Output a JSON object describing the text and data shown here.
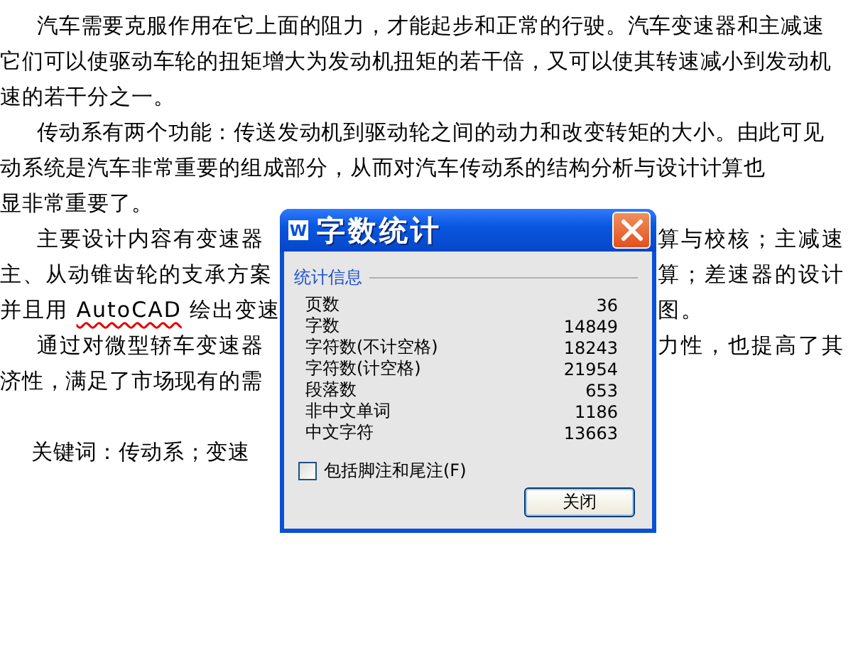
{
  "document": {
    "lines": [
      {
        "kind": "indented",
        "parts": [
          {
            "text": "汽车需要克服作用在它上面的阻力，才能起步和正常的行驶。汽车变速器和主减速",
            "misspelled": false
          }
        ]
      },
      {
        "kind": "plain",
        "parts": [
          {
            "text": "它们可以使驱动车轮的扭矩增大为发动机扭矩的若干倍，又可以使其转速减小到发动机",
            "misspelled": false
          }
        ]
      },
      {
        "kind": "plain",
        "parts": [
          {
            "text": "速的若干分之一。",
            "misspelled": false
          }
        ]
      },
      {
        "kind": "indented",
        "parts": [
          {
            "text": "传动系有两个功能：传送发动机到驱动轮之间的动力和改变转矩的大小。由此可见",
            "misspelled": false
          }
        ]
      },
      {
        "kind": "plain",
        "parts": [
          {
            "text": "动系统是汽车非常重要的组成部分，从而对汽车传动系的结构分析与设计计算也",
            "misspelled": false
          }
        ]
      },
      {
        "kind": "plain",
        "parts": [
          {
            "text": "显非常重要了。",
            "misspelled": false
          }
        ]
      },
      {
        "kind": "indented",
        "parts": [
          {
            "text": "主要设计内容有变速器",
            "misspelled": false
          }
        ],
        "right": "算与校核；主减速"
      },
      {
        "kind": "plain",
        "parts": [
          {
            "text": "主、从动锥齿轮的支承方案",
            "misspelled": false
          }
        ],
        "right": "算；差速器的设计"
      },
      {
        "kind": "plain",
        "parts": [
          {
            "text": "并且用 ",
            "misspelled": false
          },
          {
            "text": "AutoCAD",
            "misspelled": true
          },
          {
            "text": " 绘出变速",
            "misspelled": false
          }
        ],
        "right": "图。"
      },
      {
        "kind": "indented",
        "parts": [
          {
            "text": "通过对微型轿车变速器",
            "misspelled": false
          }
        ],
        "right": "力性，也提高了其"
      },
      {
        "kind": "plain",
        "parts": [
          {
            "text": "济性，满足了市场现有的需",
            "misspelled": false
          }
        ]
      },
      {
        "kind": "keywords",
        "parts": [
          {
            "text": "关键词：传动系；变速",
            "misspelled": false
          }
        ]
      }
    ]
  },
  "dialog": {
    "app_icon_letter": "W",
    "title": "字数统计",
    "group_label": "统计信息",
    "stats": [
      {
        "label": "页数",
        "value": "36"
      },
      {
        "label": "字数",
        "value": "14849"
      },
      {
        "label": "字符数(不计空格)",
        "value": "18243"
      },
      {
        "label": "字符数(计空格)",
        "value": "21954"
      },
      {
        "label": "段落数",
        "value": "653"
      },
      {
        "label": "非中文单词",
        "value": "1186"
      },
      {
        "label": "中文字符",
        "value": "13663"
      }
    ],
    "checkbox": {
      "label": "包括脚注和尾注(F)",
      "checked": false
    },
    "close_button": "关闭"
  }
}
